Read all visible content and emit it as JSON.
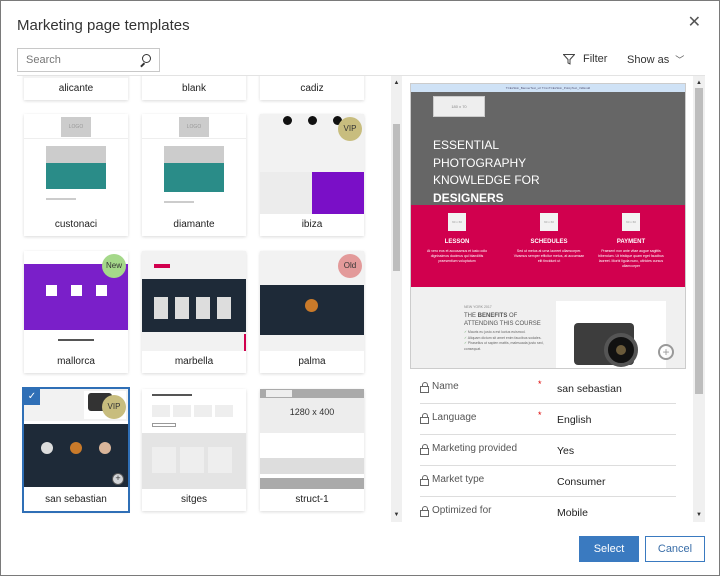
{
  "dialog": {
    "title": "Marketing page templates",
    "close_icon": "close-icon"
  },
  "toolbar": {
    "search_placeholder": "Search",
    "filter_label": "Filter",
    "show_as_label": "Show as"
  },
  "templates": [
    {
      "name": "alicante",
      "badge": null,
      "selected": false
    },
    {
      "name": "blank",
      "badge": null,
      "selected": false
    },
    {
      "name": "cadiz",
      "badge": null,
      "selected": false
    },
    {
      "name": "custonaci",
      "badge": null,
      "selected": false
    },
    {
      "name": "diamante",
      "badge": null,
      "selected": false
    },
    {
      "name": "ibiza",
      "badge": "VIP",
      "selected": false
    },
    {
      "name": "mallorca",
      "badge": "New",
      "selected": false
    },
    {
      "name": "marbella",
      "badge": null,
      "selected": false
    },
    {
      "name": "palma",
      "badge": "Old",
      "selected": false
    },
    {
      "name": "san sebastian",
      "badge": "VIP",
      "selected": true
    },
    {
      "name": "sitges",
      "badge": null,
      "selected": false
    },
    {
      "name": "struct-1",
      "badge": null,
      "selected": false
    }
  ],
  "thumb_text": {
    "logo": "LOGO",
    "struct1": "1280 x 400"
  },
  "badge_colors": {
    "VIP": "#c8bd7e",
    "New": "#a5d88a",
    "Old": "#e39a9a"
  },
  "preview": {
    "top_bar": "TCExSkin_BannerText_url TCxxTCExSkin_PolicyText_VidEndd",
    "logo_placeholder": "180 x 70",
    "headline_lines": [
      "ESSENTIAL",
      "PHOTOGRAPHY",
      "KNOWLEDGE FOR"
    ],
    "headline_bold": "DESIGNERS",
    "columns": [
      {
        "box": "60 x 60",
        "title": "LESSON",
        "text": "At vero eos et accusamus et iusto odio dignissimos ducimus qui blanditiis praesentium voluptatum"
      },
      {
        "box": "60 x 60",
        "title": "SCHEDULES",
        "text": "Sed ut metus at urna laoreet ullamcorper. Vivamus semper efficitur metus, at accumsan elit tincidunt ut"
      },
      {
        "box": "60 x 60",
        "title": "PAYMENT",
        "text": "Praesent non ante vitae augue sagittis bibendum. Ut tristique quam eget faucibus laoreet. Morbi ligula nunc, ultricies cursus ullamcorper"
      }
    ],
    "event_small": "NEW YORK 2017",
    "benefits_prefix": "THE",
    "benefits_bold": "BENEFITS",
    "benefits_suffix": "OF ATTENDING THIS COURSE",
    "benefits_list": [
      "Mauris eu justo a est luctus euismod.",
      "Aliquam dictum sit amet enim faucibus sodales.",
      "Phasellus ut sapien mattis, malesuada justo sed, consequat."
    ]
  },
  "properties": [
    {
      "label": "Name",
      "required": true,
      "value": "san sebastian"
    },
    {
      "label": "Language",
      "required": true,
      "value": "English"
    },
    {
      "label": "Marketing provided",
      "required": false,
      "value": "Yes"
    },
    {
      "label": "Market type",
      "required": false,
      "value": "Consumer"
    },
    {
      "label": "Optimized for",
      "required": false,
      "value": "Mobile"
    }
  ],
  "required_marker": "*",
  "buttons": {
    "select": "Select",
    "cancel": "Cancel"
  }
}
